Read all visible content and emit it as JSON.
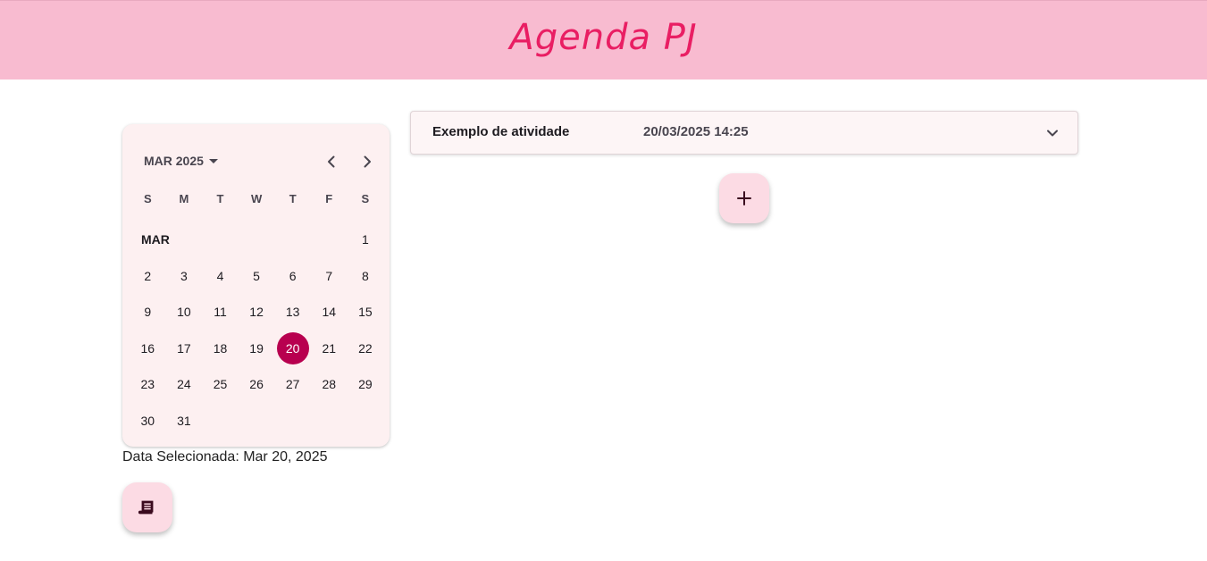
{
  "app": {
    "title": "Agenda PJ",
    "colors": {
      "header_bg": "#f8bbd0",
      "title": "#e91e63",
      "selected_day": "#b8004f",
      "fab_bg": "#fcdbe4"
    }
  },
  "calendar": {
    "month_select_label": "MAR 2025",
    "prev_icon": "chevron-left-icon",
    "next_icon": "chevron-right-icon",
    "weekdays": [
      "S",
      "M",
      "T",
      "W",
      "T",
      "F",
      "S"
    ],
    "month_label": "MAR",
    "days": [
      "1",
      "2",
      "3",
      "4",
      "5",
      "6",
      "7",
      "8",
      "9",
      "10",
      "11",
      "12",
      "13",
      "14",
      "15",
      "16",
      "17",
      "18",
      "19",
      "20",
      "21",
      "22",
      "23",
      "24",
      "25",
      "26",
      "27",
      "28",
      "29",
      "30",
      "31"
    ],
    "selected_day": "20"
  },
  "selected_date": {
    "text": "Data Selecionada: Mar 20, 2025"
  },
  "activities": [
    {
      "title": "Exemplo de atividade",
      "datetime": "20/03/2025 14:25",
      "icon": "chevron-down-icon"
    }
  ],
  "buttons": {
    "add_icon": "plus-icon",
    "report_icon": "receipt-icon"
  }
}
